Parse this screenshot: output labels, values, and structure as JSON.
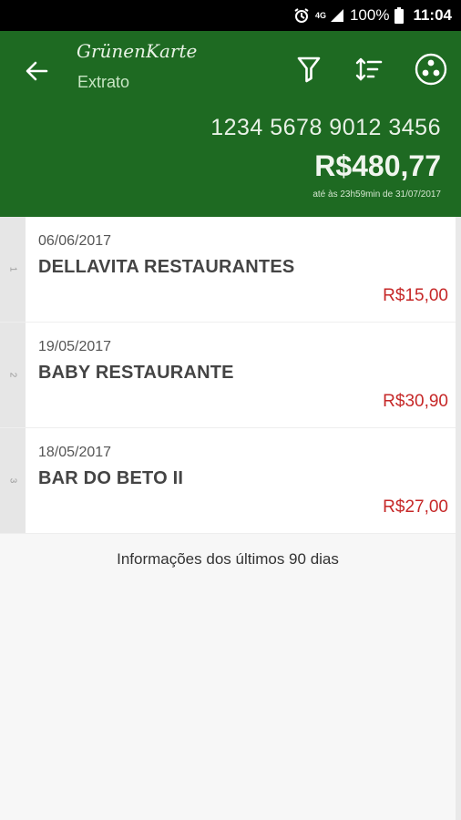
{
  "status_bar": {
    "network": "4G",
    "battery": "100%",
    "time": "11:04"
  },
  "header": {
    "brand": "GrünenKarte",
    "subtitle": "Extrato",
    "card_number": "1234 5678 9012 3456",
    "balance": "R$480,77",
    "balance_note": "até às 23h59min de 31/07/2017"
  },
  "transactions": [
    {
      "index": "1",
      "date": "06/06/2017",
      "name": "DELLAVITA RESTAURANTES",
      "amount": "R$15,00"
    },
    {
      "index": "2",
      "date": "19/05/2017",
      "name": "BABY RESTAURANTE",
      "amount": "R$30,90"
    },
    {
      "index": "3",
      "date": "18/05/2017",
      "name": "BAR DO BETO II",
      "amount": "R$27,00"
    }
  ],
  "footer": {
    "note": "Informações dos últimos 90 dias"
  },
  "colors": {
    "primary": "#1e6a22",
    "amount": "#c62828",
    "status_bar": "#000000"
  },
  "icons": [
    "alarm-icon",
    "signal-icon",
    "battery-icon",
    "back-arrow-icon",
    "filter-icon",
    "sort-icon",
    "more-circles-icon"
  ]
}
